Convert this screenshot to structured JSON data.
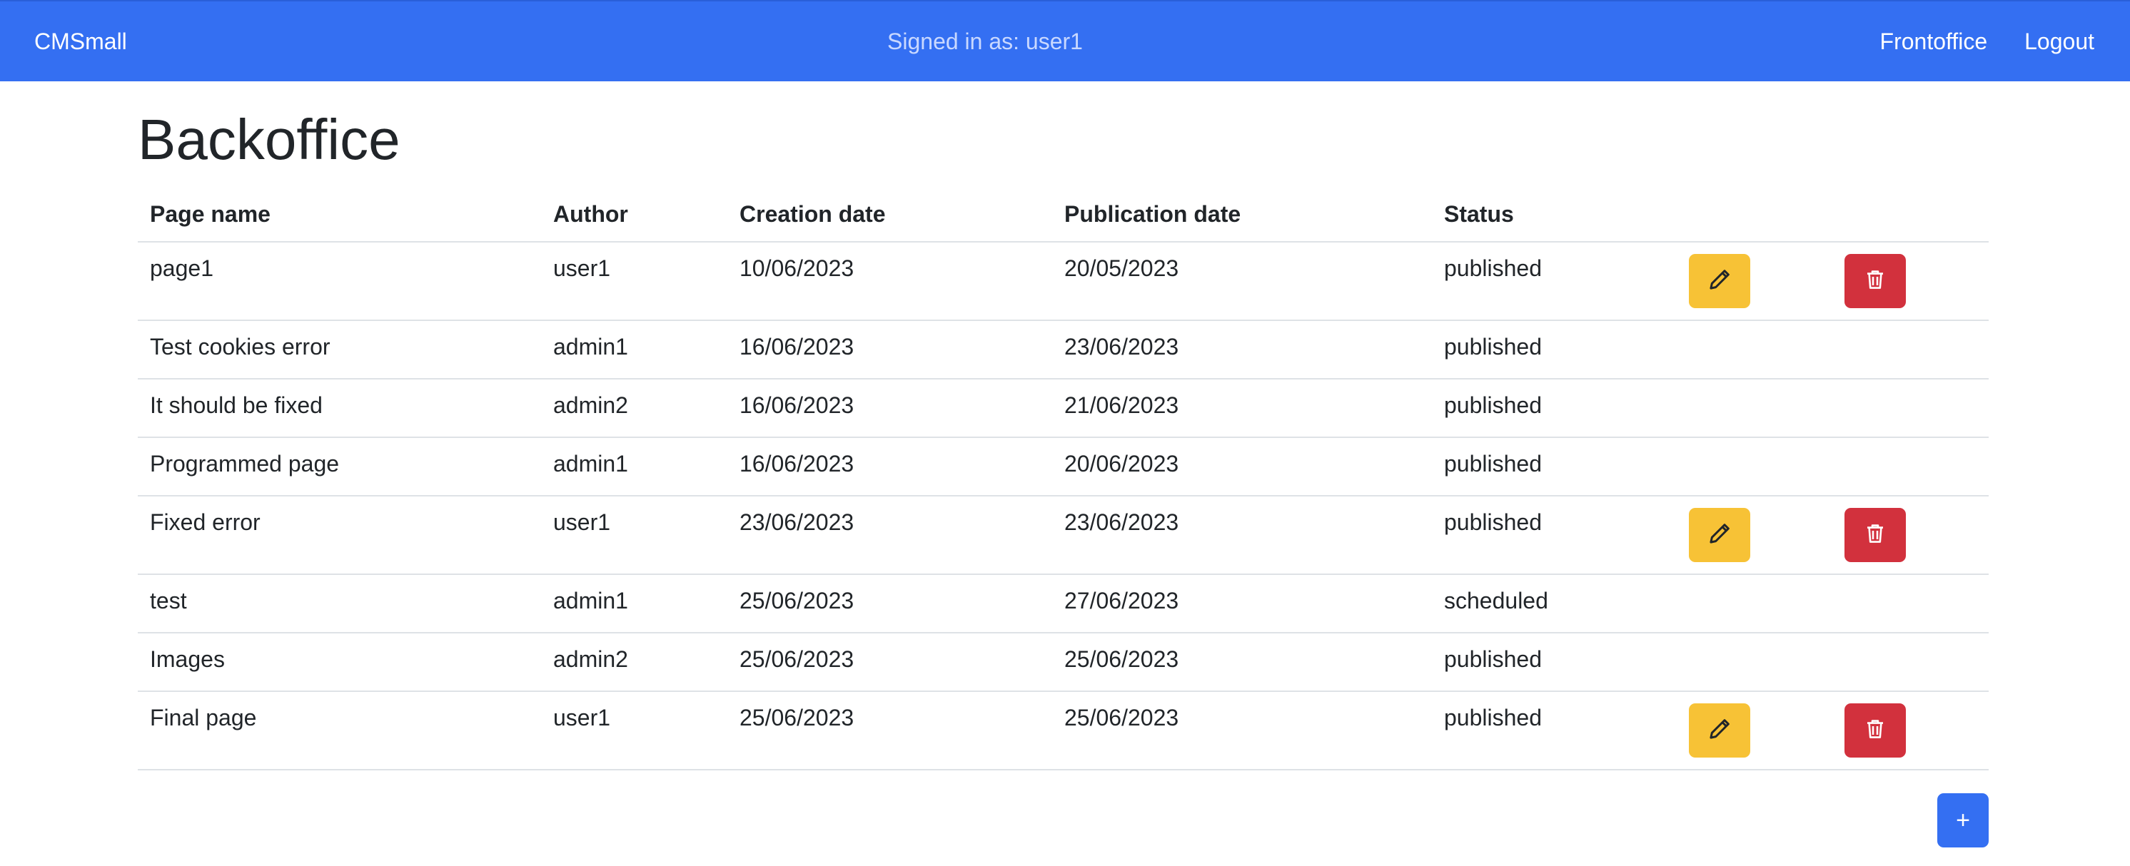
{
  "navbar": {
    "brand": "CMSmall",
    "signed_in": "Signed in as: user1",
    "links": [
      "Frontoffice",
      "Logout"
    ]
  },
  "page": {
    "title": "Backoffice"
  },
  "table": {
    "headers": [
      "Page name",
      "Author",
      "Creation date",
      "Publication date",
      "Status"
    ],
    "rows": [
      {
        "name": "page1",
        "author": "user1",
        "created": "10/06/2023",
        "published": "20/05/2023",
        "status": "published",
        "editable": true
      },
      {
        "name": "Test cookies error",
        "author": "admin1",
        "created": "16/06/2023",
        "published": "23/06/2023",
        "status": "published",
        "editable": false
      },
      {
        "name": "It should be fixed",
        "author": "admin2",
        "created": "16/06/2023",
        "published": "21/06/2023",
        "status": "published",
        "editable": false
      },
      {
        "name": "Programmed page",
        "author": "admin1",
        "created": "16/06/2023",
        "published": "20/06/2023",
        "status": "published",
        "editable": false
      },
      {
        "name": "Fixed error",
        "author": "user1",
        "created": "23/06/2023",
        "published": "23/06/2023",
        "status": "published",
        "editable": true
      },
      {
        "name": "test",
        "author": "admin1",
        "created": "25/06/2023",
        "published": "27/06/2023",
        "status": "scheduled",
        "editable": false
      },
      {
        "name": "Images",
        "author": "admin2",
        "created": "25/06/2023",
        "published": "25/06/2023",
        "status": "published",
        "editable": false
      },
      {
        "name": "Final page",
        "author": "user1",
        "created": "25/06/2023",
        "published": "25/06/2023",
        "status": "published",
        "editable": true
      }
    ]
  },
  "actions": {
    "edit_icon": "pencil-icon",
    "delete_icon": "trash-icon",
    "add_label": "+"
  },
  "colors": {
    "primary": "#346ff2",
    "warning": "#f7c236",
    "danger": "#d2313d"
  }
}
